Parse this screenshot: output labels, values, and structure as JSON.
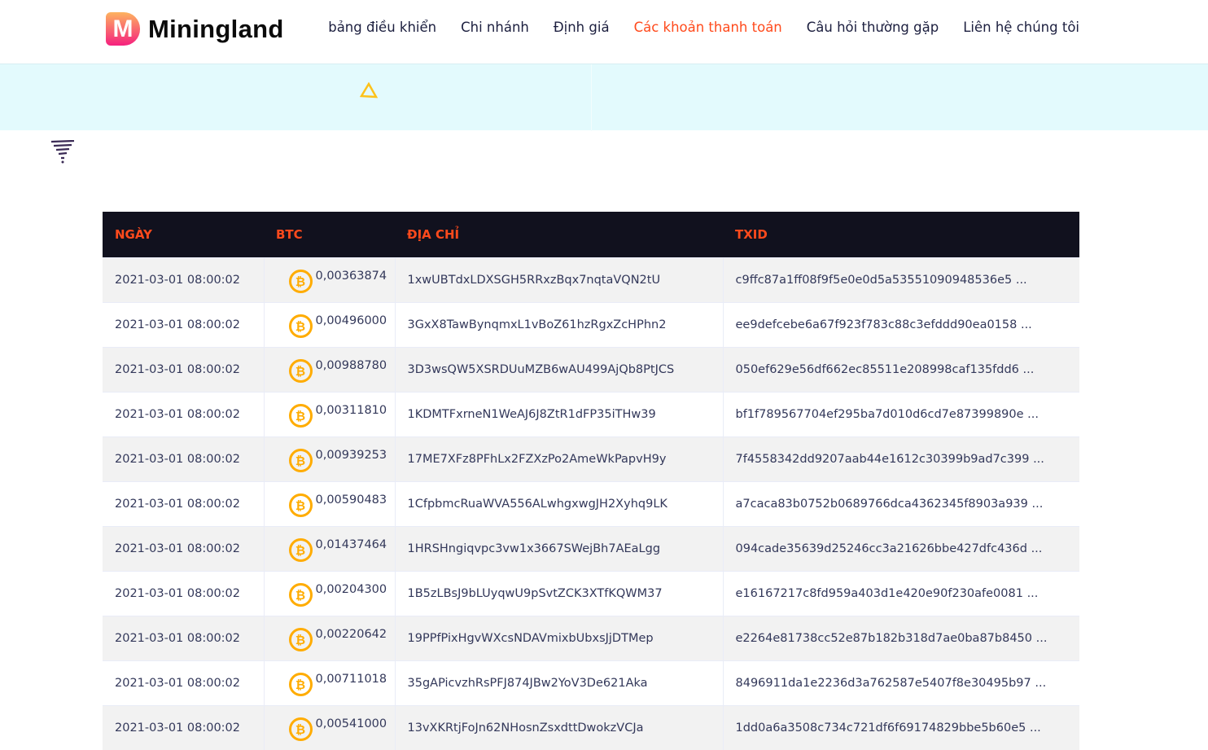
{
  "brand": {
    "logo_letter": "M",
    "name": "Miningland"
  },
  "nav": [
    "bảng điều khiển",
    "Chi nhánh",
    "Định giá",
    "Các khoản thanh toán",
    "Câu hỏi thường gặp",
    "Liên hệ chúng tôi"
  ],
  "nav_active": 3,
  "accent": "#ff4a1c",
  "table": {
    "headers": [
      "NGÀY",
      "BTC",
      "ĐỊA CHỈ",
      "TXID"
    ],
    "rows": [
      [
        "2021-03-01 08:00:02",
        "0,00363874",
        "1xwUBTdxLDXSGH5RRxzBqx7nqtaVQN2tU",
        "c9ffc87a1ff08f9f5e0e0d5a53551090948536e5 ..."
      ],
      [
        "2021-03-01 08:00:02",
        "0,00496000",
        "3GxX8TawBynqmxL1vBoZ61hzRgxZcHPhn2",
        "ee9defcebe6a67f923f783c88c3efddd90ea0158 ..."
      ],
      [
        "2021-03-01 08:00:02",
        "0,00988780",
        "3D3wsQW5XSRDUuMZB6wAU499AjQb8PtJCS",
        "050ef629e56df662ec85511e208998caf135fdd6 ..."
      ],
      [
        "2021-03-01 08:00:02",
        "0,00311810",
        "1KDMTFxrneN1WeAJ6J8ZtR1dFP35iTHw39",
        "bf1f789567704ef295ba7d010d6cd7e87399890e ..."
      ],
      [
        "2021-03-01 08:00:02",
        "0,00939253",
        "17ME7XFz8PFhLx2FZXzPo2AmeWkPapvH9y",
        "7f4558342dd9207aab44e1612c30399b9ad7c399 ..."
      ],
      [
        "2021-03-01 08:00:02",
        "0,00590483",
        "1CfpbmcRuaWVA556ALwhgxwgJH2Xyhq9LK",
        "a7caca83b0752b0689766dca4362345f8903a939 ..."
      ],
      [
        "2021-03-01 08:00:02",
        "0,01437464",
        "1HRSHngiqvpc3vw1x3667SWejBh7AEaLgg",
        "094cade35639d25246cc3a21626bbe427dfc436d ..."
      ],
      [
        "2021-03-01 08:00:02",
        "0,00204300",
        "1B5zLBsJ9bLUyqwU9pSvtZCK3XTfKQWM37",
        "e16167217c8fd959a403d1e420e90f230afe0081 ..."
      ],
      [
        "2021-03-01 08:00:02",
        "0,00220642",
        "19PPfPixHgvWXcsNDAVmixbUbxsJjDTMep",
        "e2264e81738cc52e87b182b318d7ae0ba87b8450 ..."
      ],
      [
        "2021-03-01 08:00:02",
        "0,00711018",
        "35gAPicvzhRsPFJ874JBw2YoV3De621Aka",
        "8496911da1e2236d3a762587e5407f8e30495b97 ..."
      ],
      [
        "2021-03-01 08:00:02",
        "0,00541000",
        "13vXKRtjFoJn62NHosnZsxdttDwokzVCJa",
        "1dd0a6a3508c734c721df6f69174829bbe5b60e5 ..."
      ]
    ]
  }
}
